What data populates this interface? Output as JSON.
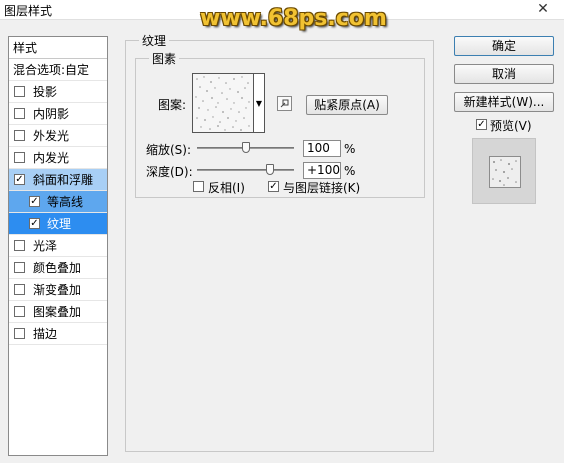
{
  "window": {
    "title": "图层样式",
    "close_glyph": "✕"
  },
  "watermark": "www.68ps.com",
  "left_panel": {
    "header": "样式",
    "blend_options": "混合选项:自定",
    "items": [
      {
        "label": "投影",
        "checked": false
      },
      {
        "label": "内阴影",
        "checked": false
      },
      {
        "label": "外发光",
        "checked": false
      },
      {
        "label": "内发光",
        "checked": false
      },
      {
        "label": "斜面和浮雕",
        "checked": true
      },
      {
        "label": "等高线",
        "checked": true
      },
      {
        "label": "纹理",
        "checked": true
      },
      {
        "label": "光泽",
        "checked": false
      },
      {
        "label": "颜色叠加",
        "checked": false
      },
      {
        "label": "渐变叠加",
        "checked": false
      },
      {
        "label": "图案叠加",
        "checked": false
      },
      {
        "label": "描边",
        "checked": false
      }
    ]
  },
  "texture": {
    "group_title": "纹理",
    "subgroup_title": "图素",
    "pattern_label": "图案:",
    "snap_button": "贴紧原点(A)",
    "scale_label": "缩放(S):",
    "scale_value": "100",
    "scale_unit": "%",
    "scale_position": 0.5,
    "depth_label": "深度(D):",
    "depth_value": "+100",
    "depth_unit": "%",
    "depth_position": 0.75,
    "invert_label": "反相(I)",
    "invert_checked": false,
    "link_label": "与图层链接(K)",
    "link_checked": true
  },
  "buttons": {
    "ok": "确定",
    "cancel": "取消",
    "new_style": "新建样式(W)...",
    "preview_label": "预览(V)",
    "preview_checked": true
  },
  "colors": {
    "selected_light": "#a8cff5",
    "selected_mid": "#5ea7ee",
    "selected_dark": "#2d8df0",
    "watermark": "#f1c232"
  },
  "check_glyph": "✓"
}
